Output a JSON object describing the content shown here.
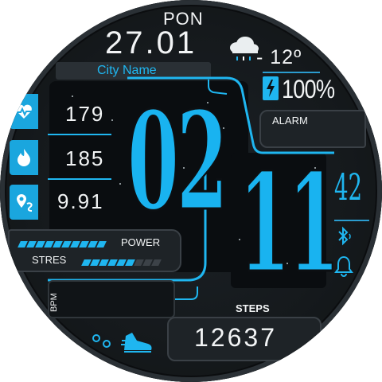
{
  "header": {
    "day": "PON",
    "date": "27.01",
    "city": "City Name"
  },
  "weather": {
    "icon": "cloud-rain-icon",
    "temperature": "- 12º"
  },
  "battery": {
    "icon": "battery-charging-icon",
    "percent": "100%"
  },
  "health": {
    "heart_rate": "179",
    "calories": "185",
    "distance": "9.91"
  },
  "time": {
    "hour": "02",
    "minute": "11",
    "seconds": "42"
  },
  "labels": {
    "alarm": "ALARM",
    "power": "POWER",
    "stres": "STRES",
    "bpm": "BPM",
    "steps": "STEPS"
  },
  "bars": {
    "power_level": 1.0,
    "stres_level": 0.6
  },
  "steps": {
    "count": "12637"
  },
  "icons": [
    "heart-pulse-icon",
    "flame-icon",
    "map-pin-icon",
    "bluetooth-icon",
    "bell-icon",
    "shoe-icon",
    "dots-icon"
  ],
  "colors": {
    "accent": "#1fb6f0",
    "background": "#15191c",
    "text": "#f2f4f5"
  }
}
